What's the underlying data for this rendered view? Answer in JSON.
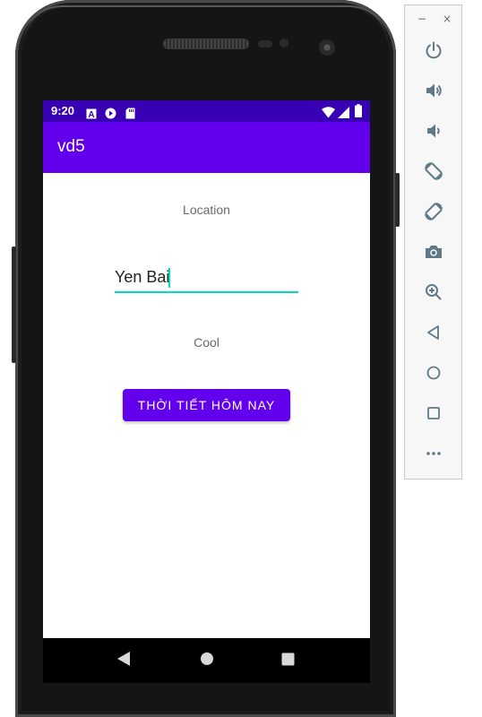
{
  "device": {
    "status_bar": {
      "time": "9:20"
    },
    "app_bar": {
      "title": "vd5"
    },
    "screen": {
      "location_label": "Location",
      "location_input_value": "Yen Bai",
      "weather_label": "Cool",
      "weather_button_label": "THỜI TIẾT HÔM NAY"
    },
    "nav": {
      "back_icon": "back-triangle-icon",
      "home_icon": "home-circle-icon",
      "recents_icon": "recents-square-icon"
    }
  },
  "emulator_toolbar": {
    "minimize": "−",
    "close": "×",
    "buttons": [
      {
        "name": "power",
        "icon": "power-icon"
      },
      {
        "name": "volume-up",
        "icon": "volume-up-icon"
      },
      {
        "name": "volume-down",
        "icon": "volume-down-icon"
      },
      {
        "name": "rotate-left",
        "icon": "rotate-left-icon"
      },
      {
        "name": "rotate-right",
        "icon": "rotate-right-icon"
      },
      {
        "name": "screenshot",
        "icon": "camera-icon"
      },
      {
        "name": "zoom",
        "icon": "zoom-icon"
      },
      {
        "name": "back",
        "icon": "back-icon"
      },
      {
        "name": "home",
        "icon": "home-icon"
      },
      {
        "name": "overview",
        "icon": "overview-icon"
      },
      {
        "name": "more",
        "icon": "more-icon"
      }
    ]
  },
  "colors": {
    "status_bar": "#3700b3",
    "app_bar": "#6200ee",
    "button": "#6200ee",
    "accent": "#03dac5",
    "toolbar_icon": "#5f7a86"
  }
}
